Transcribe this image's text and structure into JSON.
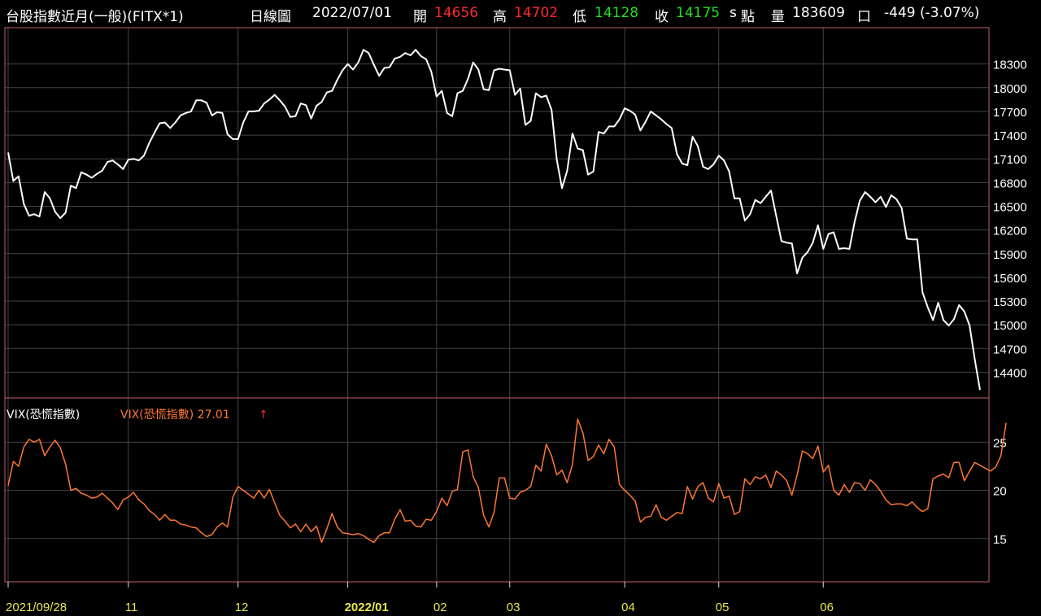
{
  "header": {
    "name": "台股指數近月(一般)(FITX*1)",
    "period": "日線圖",
    "date": "2022/07/01",
    "open_label": "開",
    "open": "14656",
    "high_label": "高",
    "high": "14702",
    "low_label": "低",
    "low": "14128",
    "close_label": "收",
    "close": "14175",
    "close_flag": "s",
    "points_label": "點",
    "volume_label": "量",
    "volume": "183609",
    "volume_unit": "口",
    "change": "-449 (-3.07%)"
  },
  "lower_panel": {
    "title": "VIX(恐慌指數)",
    "legend": "VIX(恐慌指數) 27.01",
    "arrow": "↑"
  },
  "colors": {
    "price": "#ffffff",
    "vix": "#ff7733",
    "up": "#ff2a2a",
    "down": "#22e022",
    "grid": "#444444",
    "border": "#c0606a",
    "date_label": "#e8e84a"
  },
  "chart_data": [
    {
      "type": "line",
      "series": [
        {
          "values": [
            17180,
            16820,
            16880,
            16530,
            16380,
            16400,
            16370,
            16680,
            16600,
            16430,
            16350,
            16420,
            16760,
            16730,
            16930,
            16900,
            16860,
            16910,
            16950,
            17060,
            17080,
            17030,
            16970,
            17090,
            17100,
            17080,
            17140,
            17300,
            17430,
            17550,
            17560,
            17490,
            17560,
            17650,
            17680,
            17700,
            17840,
            17840,
            17810,
            17650,
            17690,
            17680,
            17410,
            17350,
            17350,
            17560,
            17700,
            17700,
            17710,
            17800,
            17850,
            17910,
            17840,
            17760,
            17630,
            17640,
            17800,
            17780,
            17610,
            17770,
            17820,
            17940,
            17960,
            18100,
            18220,
            18300,
            18230,
            18320,
            18480,
            18440,
            18290,
            18150,
            18250,
            18260,
            18370,
            18390,
            18440,
            18410,
            18480,
            18400,
            18360,
            18200,
            17890,
            17960,
            17680,
            17640,
            17930,
            17960,
            18110,
            18320,
            18230,
            17980,
            17970,
            18220,
            18240,
            18230,
            18220,
            17910,
            17990,
            17530,
            17580,
            17930,
            17880,
            17900,
            17720,
            17090,
            16730,
            16950,
            17420,
            17230,
            17210,
            16900,
            16940,
            17440,
            17420,
            17510,
            17510,
            17600,
            17740,
            17710,
            17660,
            17460,
            17570,
            17700,
            17650,
            17600,
            17540,
            17490,
            17160,
            17040,
            17020,
            17380,
            17260,
            17000,
            16970,
            17030,
            17140,
            17080,
            16940,
            16600,
            16600,
            16320,
            16400,
            16580,
            16540,
            16620,
            16700,
            16380,
            16060,
            16040,
            16030,
            15650,
            15850,
            15920,
            16040,
            16260,
            15960,
            16150,
            16170,
            15960,
            15970,
            15960,
            16300,
            16570,
            16680,
            16620,
            16550,
            16620,
            16490,
            16640,
            16590,
            16480,
            16090,
            16080,
            16080,
            15410,
            15220,
            15060,
            15280,
            15060,
            14990,
            15070,
            15250,
            15170,
            14990,
            14560,
            14175
          ]
        }
      ],
      "ylim": [
        14075,
        18760
      ],
      "yticks": [
        14400,
        14700,
        15000,
        15300,
        15600,
        15900,
        16200,
        16500,
        16800,
        17100,
        17400,
        17700,
        18000,
        18300
      ]
    },
    {
      "type": "line",
      "series": [
        {
          "name": "VIX(恐慌指數)",
          "values": [
            20.5,
            23,
            22.5,
            24.5,
            25.3,
            25,
            25.3,
            23.6,
            24.5,
            25.2,
            24.4,
            22.7,
            20,
            20.2,
            19.7,
            19.5,
            19.2,
            19.3,
            19.7,
            19.2,
            18.7,
            18,
            19,
            19.3,
            19.8,
            19,
            18.6,
            17.9,
            17.5,
            16.9,
            17.5,
            16.9,
            16.9,
            16.5,
            16.4,
            16.2,
            16.1,
            15.6,
            15.2,
            15.4,
            16.2,
            16.6,
            16.2,
            19.3,
            20.4,
            20,
            19.6,
            19.2,
            20,
            19.2,
            20.1,
            18.7,
            17.4,
            16.8,
            16.1,
            16.5,
            15.7,
            16.5,
            15.7,
            16.3,
            14.6,
            16,
            17.6,
            16.2,
            15.6,
            15.5,
            15.4,
            15.5,
            15.3,
            14.9,
            14.6,
            15.3,
            15.6,
            15.6,
            17,
            18,
            16.8,
            16.9,
            16.3,
            16.2,
            17,
            16.9,
            17.8,
            19.2,
            18.4,
            19.9,
            20.1,
            24,
            24.2,
            21.4,
            20.3,
            17.4,
            16.2,
            17.7,
            21.3,
            21.3,
            19.2,
            19.1,
            19.8,
            20,
            20.4,
            22.6,
            22,
            24.8,
            23.6,
            21.6,
            22.1,
            20.8,
            22.7,
            27.4,
            26,
            23.1,
            23.5,
            24.7,
            23.8,
            25.3,
            24.5,
            20.6,
            20,
            19.5,
            18.9,
            16.7,
            17.2,
            17.3,
            18.5,
            17.2,
            16.9,
            17.3,
            17.7,
            17.6,
            20.4,
            19.1,
            20.4,
            20.8,
            19.2,
            18.8,
            20.7,
            19.2,
            19.4,
            17.5,
            17.8,
            21.2,
            20.6,
            21.4,
            21.2,
            21.6,
            20.3,
            22,
            21.6,
            21,
            19.5,
            21.6,
            24.1,
            23.8,
            23.3,
            24.6,
            21.9,
            22.6,
            20,
            19.5,
            20.6,
            19.8,
            20.8,
            20.7,
            20,
            21.1,
            20.6,
            19.9,
            19,
            18.5,
            18.6,
            18.6,
            18.4,
            18.8,
            18.2,
            17.8,
            18.1,
            21.2,
            21.5,
            21.7,
            21.3,
            22.9,
            22.9,
            21,
            22,
            22.9,
            22.6,
            22.3,
            22,
            22.4,
            23.6,
            27.01
          ]
        }
      ],
      "ylim": [
        10.5,
        29.6
      ],
      "yticks": [
        15,
        20,
        25
      ]
    }
  ],
  "x_axis": {
    "labels": [
      {
        "text": "2021/09/28",
        "index": 0
      },
      {
        "text": "11",
        "index": 23
      },
      {
        "text": "12",
        "index": 44
      },
      {
        "text": "2022/01",
        "index": 65
      },
      {
        "text": "02",
        "index": 82
      },
      {
        "text": "03",
        "index": 96
      },
      {
        "text": "04",
        "index": 118
      },
      {
        "text": "05",
        "index": 136
      },
      {
        "text": "06",
        "index": 156
      }
    ]
  }
}
